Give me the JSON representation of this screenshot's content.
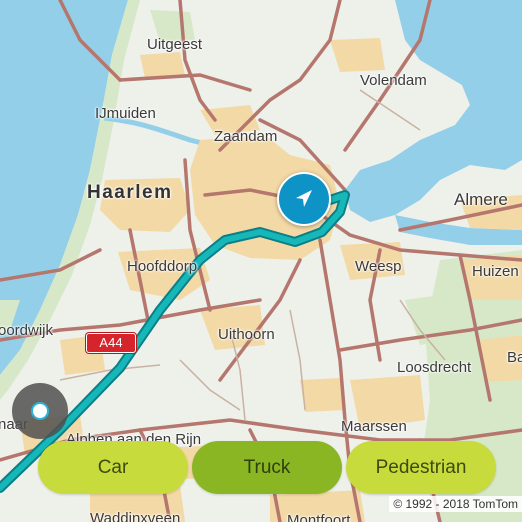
{
  "map": {
    "places": [
      {
        "name": "Uitgeest",
        "style": "normal"
      },
      {
        "name": "Volendam",
        "style": "normal"
      },
      {
        "name": "IJmuiden",
        "style": "normal"
      },
      {
        "name": "Zaandam",
        "style": "normal"
      },
      {
        "name": "Haarlem",
        "style": "big"
      },
      {
        "name": "Almere",
        "style": "normal"
      },
      {
        "name": "Hoofddorp",
        "style": "normal"
      },
      {
        "name": "Weesp",
        "style": "normal"
      },
      {
        "name": "Huizen",
        "style": "normal"
      },
      {
        "name": "oordwijk",
        "style": "normal"
      },
      {
        "name": "Uithoorn",
        "style": "normal"
      },
      {
        "name": "Loosdrecht",
        "style": "normal"
      },
      {
        "name": "naar",
        "style": "normal"
      },
      {
        "name": "Alphen aan den Rijn",
        "style": "normal"
      },
      {
        "name": "Maarssen",
        "style": "normal"
      },
      {
        "name": "Waddinxveen",
        "style": "normal"
      },
      {
        "name": "Montfoort",
        "style": "normal"
      },
      {
        "name": "Ba",
        "style": "normal"
      }
    ],
    "road_shield": "A44",
    "copyright": "© 1992 - 2018 TomTom",
    "colors": {
      "water": "#93cfe8",
      "land": "#eef0ea",
      "urban": "#f3d9a6",
      "green": "#d7e8c9",
      "road": "#b5766e",
      "route": "#16b7b9",
      "marker": "#0e93c6"
    }
  },
  "modes": {
    "car": "Car",
    "truck": "Truck",
    "pedestrian": "Pedestrian",
    "selected": "Truck"
  },
  "markers": {
    "destination_icon": "navigation-arrow-icon",
    "current_location_icon": "gps-location-icon"
  }
}
